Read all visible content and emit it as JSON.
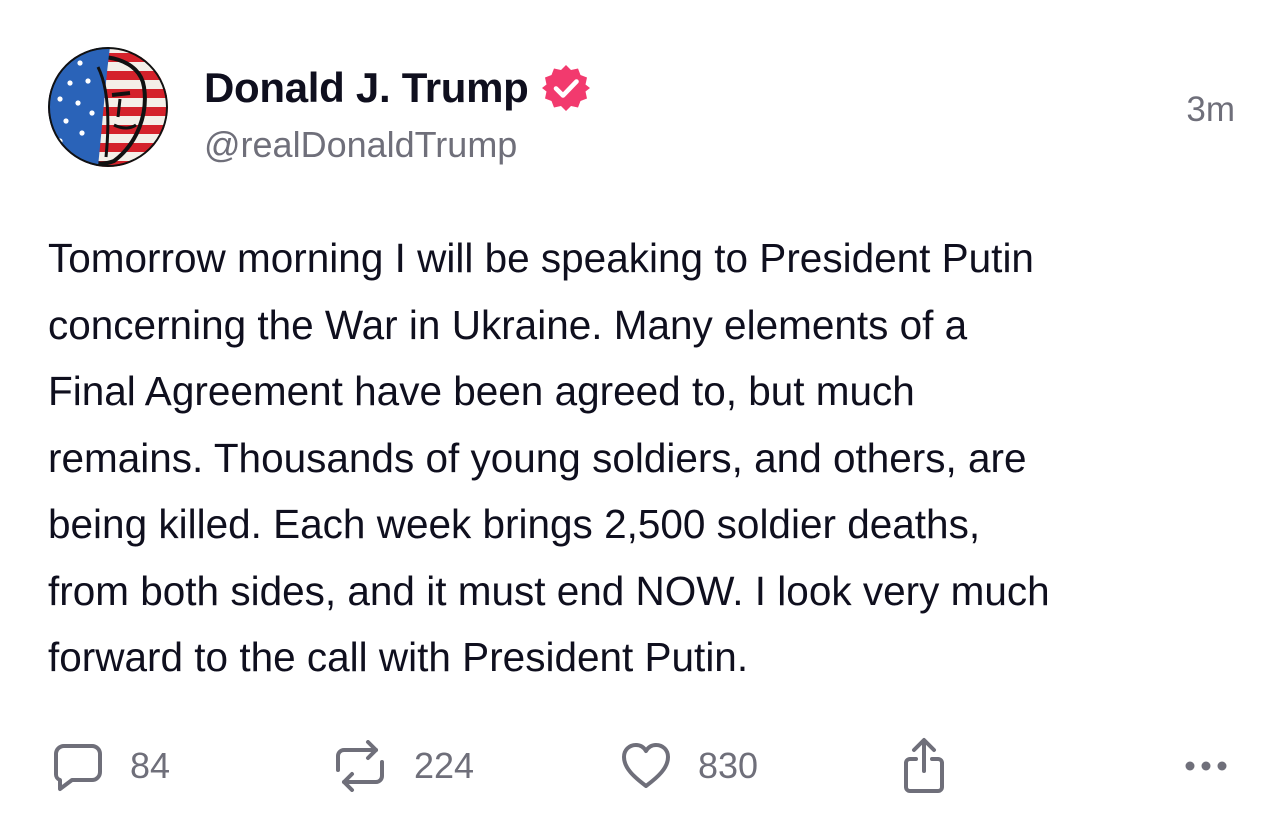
{
  "author": {
    "display_name": "Donald J. Trump",
    "handle": "@realDonaldTrump",
    "verified": true,
    "verified_color": "#f23a6e"
  },
  "timestamp": "3m",
  "body": "Tomorrow morning I will be speaking to President Putin\nconcerning the War in Ukraine. Many elements of a\nFinal Agreement have been agreed to, but much\nremains. Thousands of young soldiers, and others, are\nbeing killed. Each week brings 2,500 soldier deaths,\nfrom both sides, and it must end NOW. I look very much\nforward to the call with President Putin.",
  "actions": {
    "replies": "84",
    "retruths": "224",
    "likes": "830",
    "reply_icon": "speech-bubble-icon",
    "retruth_icon": "repost-arrows-icon",
    "like_icon": "heart-icon",
    "share_icon": "share-icon",
    "more_icon": "more-dots-icon"
  },
  "colors": {
    "text": "#0f0f1e",
    "muted": "#6f6f7a"
  }
}
